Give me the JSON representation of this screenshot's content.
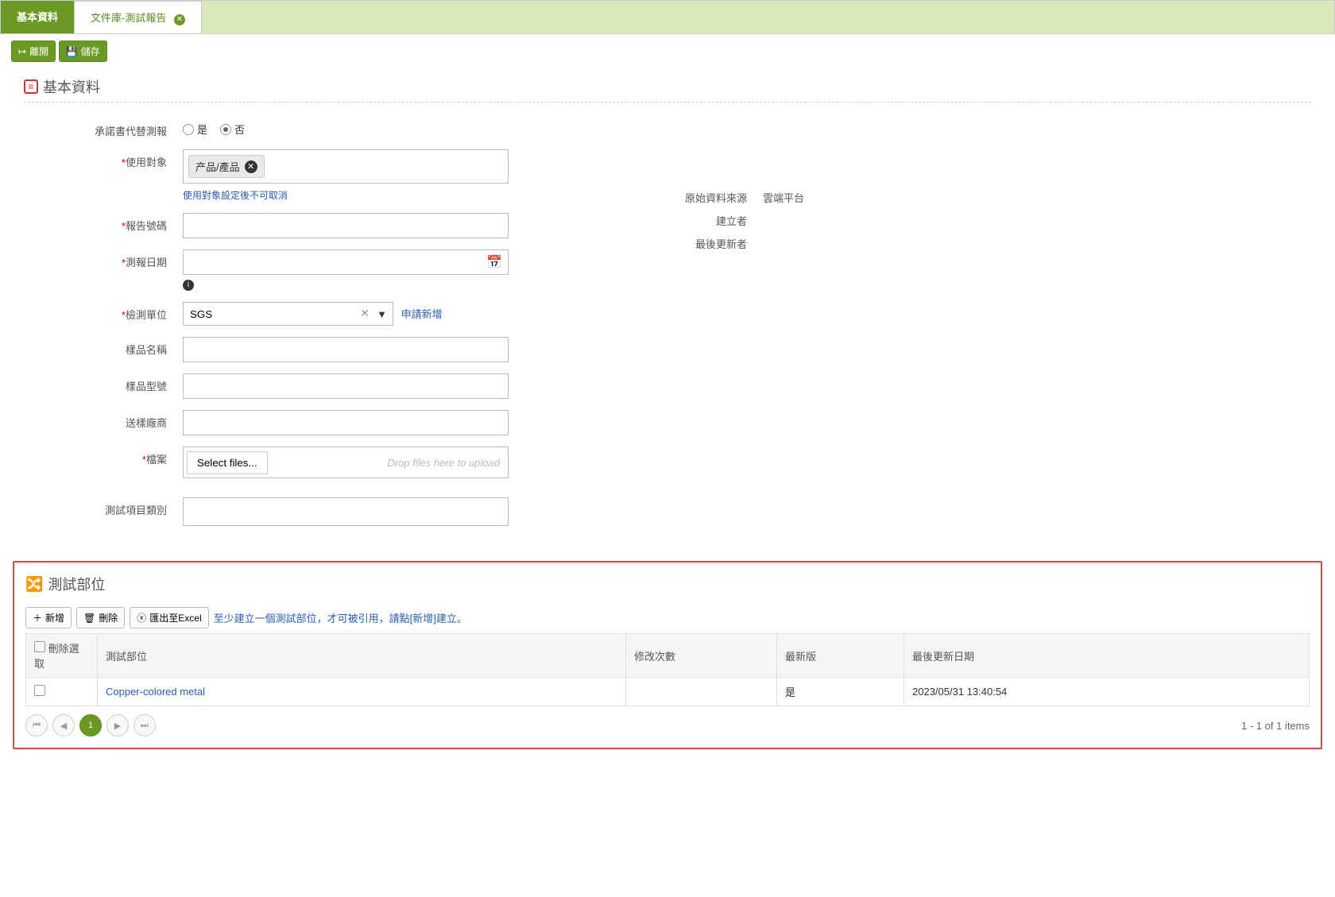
{
  "tabs": {
    "primary": "基本資料",
    "secondary": "文件庫-測試報告"
  },
  "toolbar": {
    "leave": "離開",
    "save": "儲存"
  },
  "section1": {
    "title": "基本資料"
  },
  "form": {
    "commitment_label": "承諾書代替測報",
    "commitment_yes": "是",
    "commitment_no": "否",
    "usage_label": "使用對象",
    "usage_tag": "产品/產品",
    "usage_help": "使用對象設定後不可取消",
    "report_no_label": "報告號碼",
    "report_date_label": "測報日期",
    "test_org_label": "檢測單位",
    "test_org_value": "SGS",
    "apply_new": "申請新增",
    "sample_name_label": "樣品名稱",
    "sample_model_label": "樣品型號",
    "vendor_label": "送樣廠商",
    "file_label": "檔案",
    "file_button": "Select files...",
    "file_hint": "Drop files here to upload",
    "test_category_label": "測試項目類別"
  },
  "right": {
    "source_label": "原始資料來源",
    "source_value": "雲端平台",
    "creator_label": "建立者",
    "updater_label": "最後更新者"
  },
  "section2": {
    "title": "測試部位",
    "btn_add": "新增",
    "btn_delete": "刪除",
    "btn_export": "匯出至Excel",
    "hint": "至少建立一個測試部位，才可被引用，請點[新增]建立。",
    "col_select": "刪除選取",
    "col_part": "測試部位",
    "col_modcount": "修改次數",
    "col_latest": "最新版",
    "col_updated": "最後更新日期",
    "row": {
      "part": "Copper-colored metal",
      "modcount": "",
      "latest": "是",
      "updated": "2023/05/31 13:40:54"
    },
    "pager_info": "1 - 1 of 1 items",
    "page_current": "1"
  }
}
